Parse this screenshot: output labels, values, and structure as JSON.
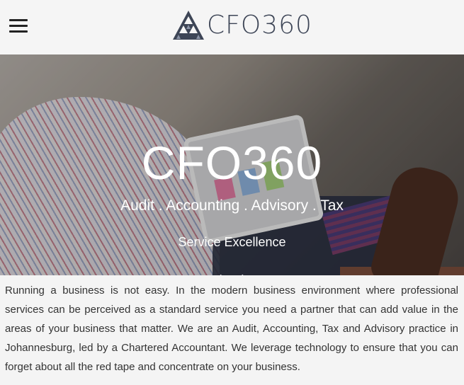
{
  "header": {
    "logo_text": "CFO360"
  },
  "hero": {
    "title": "CFO360",
    "subtitle": "Audit . Accounting . Advisory . Tax",
    "tagline": "Service Excellence"
  },
  "content": {
    "paragraph": "Running a business is not easy.  In the modern business environment where professional services can be perceived as a standard service you need a partner that can add value in the areas of your business that matter. We are an Audit, Accounting, Tax and Advisory practice in Johannesburg, led by a Chartered Accountant.  We leverage technology to ensure that you can forget about all the red tape and concentrate on your business."
  },
  "icons": {
    "menu": "hamburger-menu-icon",
    "logo": "triangle-logo-icon",
    "scroll": "chevron-down-icon"
  },
  "colors": {
    "logo_text": "#3d4556",
    "background": "#f4f4f4"
  }
}
